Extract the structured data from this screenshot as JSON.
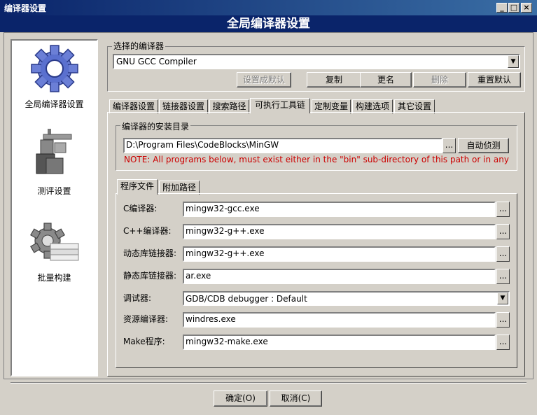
{
  "window": {
    "title": "编译器设置"
  },
  "header": {
    "title": "全局编译器设置"
  },
  "sidebar": {
    "items": [
      {
        "label": "全局编译器设置",
        "icon": "gear-icon"
      },
      {
        "label": "测评设置",
        "icon": "caliper-icon"
      },
      {
        "label": "批量构建",
        "icon": "gear-stack-icon"
      }
    ]
  },
  "compiler_select": {
    "group_label": "选择的编译器",
    "selected": "GNU GCC Compiler",
    "buttons": {
      "set_default": "设置成默认",
      "copy": "复制",
      "rename": "更名",
      "delete": "删除",
      "reset_default": "重置默认"
    }
  },
  "tabs": [
    "编译器设置",
    "链接器设置",
    "搜索路径",
    "可执行工具链",
    "定制变量",
    "构建选项",
    "其它设置"
  ],
  "active_tab": "可执行工具链",
  "install_dir": {
    "group_label": "编译器的安装目录",
    "path": "D:\\Program Files\\CodeBlocks\\MinGW",
    "browse_label": "...",
    "autodetect_label": "自动侦测",
    "note": "NOTE: All programs below, must exist either in the \"bin\" sub-directory of this path or in any of the"
  },
  "inner_tabs": [
    "程序文件",
    "附加路径"
  ],
  "programs": [
    {
      "label": "C编译器:",
      "value": "mingw32-gcc.exe",
      "kind": "text"
    },
    {
      "label": "C++编译器:",
      "value": "mingw32-g++.exe",
      "kind": "text"
    },
    {
      "label": "动态库链接器:",
      "value": "mingw32-g++.exe",
      "kind": "text"
    },
    {
      "label": "静态库链接器:",
      "value": "ar.exe",
      "kind": "text"
    },
    {
      "label": "调试器:",
      "value": "GDB/CDB debugger : Default",
      "kind": "select"
    },
    {
      "label": "资源编译器:",
      "value": "windres.exe",
      "kind": "text"
    },
    {
      "label": "Make程序:",
      "value": "mingw32-make.exe",
      "kind": "text"
    }
  ],
  "dots_label": "...",
  "footer": {
    "ok": "确定(O)",
    "cancel": "取消(C)"
  },
  "colors": {
    "titlebar": "#0a246a",
    "note": "#cc0000",
    "face": "#d4d0c8"
  }
}
